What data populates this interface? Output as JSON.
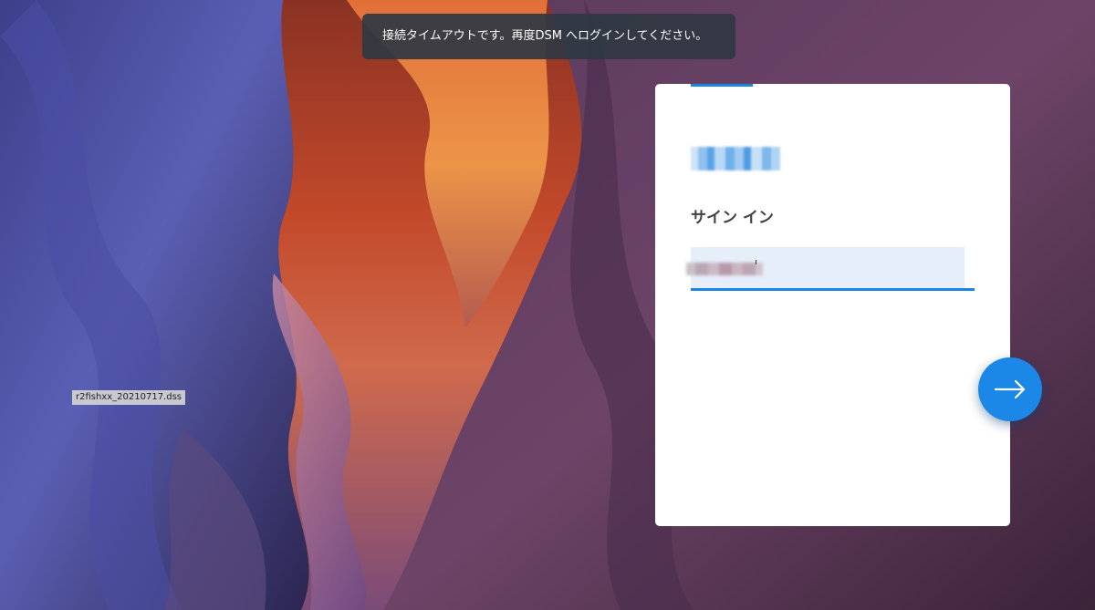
{
  "notification": {
    "message": "接続タイムアウトです。再度DSM へログインしてください。"
  },
  "desktop": {
    "file_label": "r2fishxx_20210717.dss"
  },
  "login": {
    "title": "サイン イン",
    "username_value": "",
    "logo_icon": "blurred-logo",
    "next_icon": "arrow-right-icon"
  },
  "colors": {
    "accent": "#1a86e4",
    "card": "#ffffff",
    "field_bg": "#e6eef9",
    "toast_bg": "#303842"
  }
}
